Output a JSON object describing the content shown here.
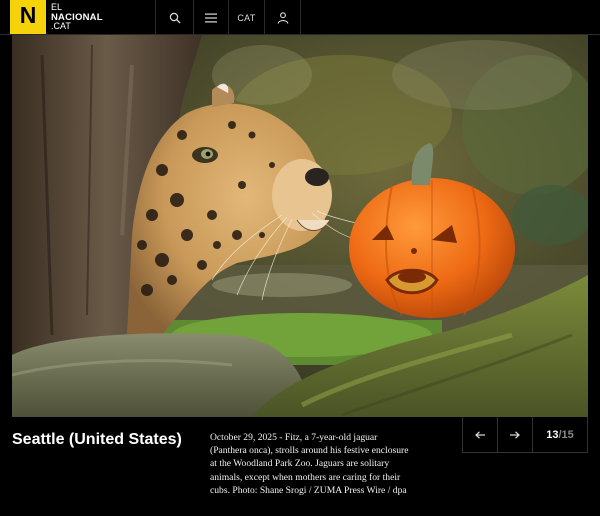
{
  "header": {
    "logo_letter": "N",
    "logo_line1": "EL",
    "logo_line2": "NACIONAL",
    "logo_line3": ".CAT",
    "cat_label": "CAT"
  },
  "photo": {
    "subject": "jaguar-and-pumpkin"
  },
  "caption": {
    "location": "Seattle (United States)",
    "text": "October 29, 2025 - Fitz, a 7-year-old jaguar (Panthera onca), strolls around his festive enclosure at the Woodland Park Zoo. Jaguars are solitary animals, except when mothers are caring for their cubs. Photo: Shane Srogi / ZUMA Press Wire / dpa"
  },
  "gallery": {
    "current": "13",
    "separator": "/",
    "total": "15"
  },
  "colors": {
    "brand_yellow": "#f6d20a",
    "background": "#000000"
  }
}
